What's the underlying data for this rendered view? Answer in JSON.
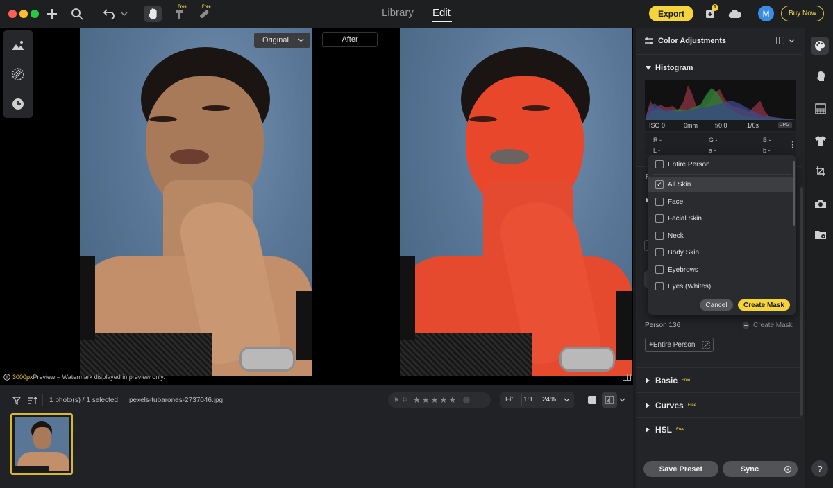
{
  "topbar": {
    "free1": "Free",
    "free2": "Free",
    "tab_library": "Library",
    "tab_edit": "Edit",
    "export": "Export",
    "notif_count": "1",
    "avatar": "M",
    "buy": "Buy Now"
  },
  "canvas": {
    "original_label": "Original",
    "after_label": "After",
    "preview_px": "3000px",
    "preview_note": " Preview – Watermark displayed in preview only."
  },
  "filmstrip": {
    "count": "1 photo(s) / 1 selected",
    "filename": "pexels-tubarones-2737046.jpg",
    "fit": "Fit",
    "one": "1:1",
    "zoom": "24%"
  },
  "panel": {
    "title": "Color Adjustments",
    "histogram": "Histogram",
    "iso": "ISO 0",
    "mm": "0mm",
    "f": "f/0.0",
    "shutter": "1/0s",
    "fmt": "JPG",
    "r": "R -",
    "g": "G -",
    "b": "B -",
    "l": "L -",
    "a": "a -",
    "bb": "b -",
    "person": "Person 136",
    "create_mask_link": "Create Mask",
    "entire_person_btn": "+Entire Person",
    "basic": "Basic",
    "curves": "Curves",
    "hsl": "HSL",
    "free": "Free",
    "save_preset": "Save Preset",
    "sync": "Sync",
    "r_letter": "R"
  },
  "dropdown": {
    "items": [
      {
        "label": "Entire Person",
        "checked": false
      },
      {
        "label": "All Skin",
        "checked": true
      },
      {
        "label": "Face",
        "checked": false
      },
      {
        "label": "Facial Skin",
        "checked": false
      },
      {
        "label": "Neck",
        "checked": false
      },
      {
        "label": "Body Skin",
        "checked": false
      },
      {
        "label": "Eyebrows",
        "checked": false
      },
      {
        "label": "Eyes (Whites)",
        "checked": false
      }
    ],
    "cancel": "Cancel",
    "create": "Create Mask"
  },
  "help": "?",
  "colors": {
    "accent": "#f5d33a",
    "mask": "#e8472c",
    "avatar": "#3a8de0"
  }
}
